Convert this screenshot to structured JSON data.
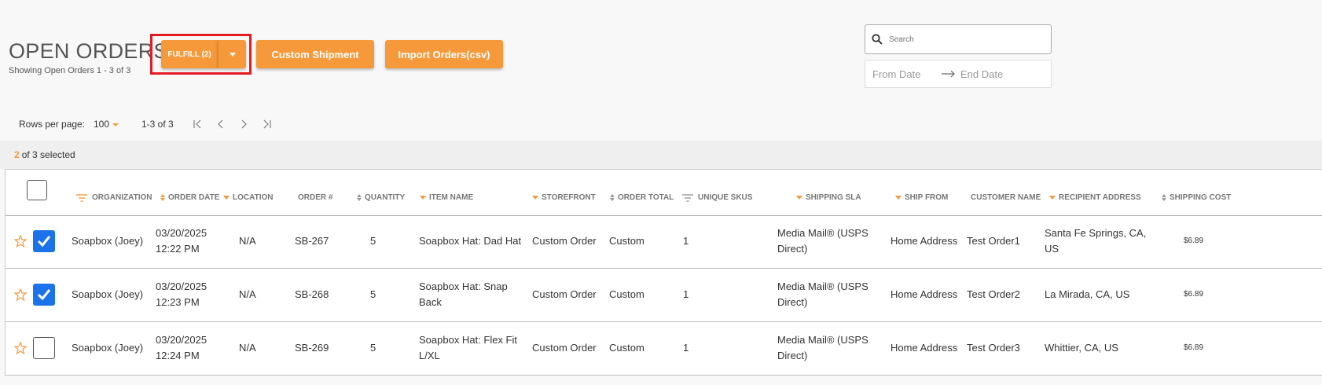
{
  "header": {
    "title": "OPEN ORDERS",
    "subtitle": "Showing Open Orders 1 - 3 of 3"
  },
  "toolbar": {
    "fulfill_label": "FULFILL (2)",
    "custom_shipment_label": "Custom Shipment",
    "import_orders_label": "Import Orders(csv)"
  },
  "search": {
    "placeholder": "Search"
  },
  "date_range": {
    "from_placeholder": "From Date",
    "end_placeholder": "End Date"
  },
  "pagination": {
    "rows_label": "Rows per page:",
    "rows_value": "100",
    "range": "1-3 of 3"
  },
  "selection": {
    "count": "2",
    "text": "of 3 selected"
  },
  "table": {
    "columns": {
      "organization": "ORGANIZATION",
      "order_date": "ORDER DATE",
      "location": "LOCATION",
      "order_no": "ORDER #",
      "quantity": "QUANTITY",
      "item_name": "ITEM NAME",
      "storefront": "STOREFRONT",
      "order_total": "ORDER TOTAL",
      "unique_skus": "UNIQUE SKUS",
      "shipping_sla": "SHIPPING SLA",
      "ship_from": "SHIP FROM",
      "customer_name": "CUSTOMER NAME",
      "recipient_address": "RECIPIENT ADDRESS",
      "shipping_cost": "SHIPPING COST"
    },
    "rows": [
      {
        "checked": true,
        "organization": "Soapbox (Joey)",
        "date": "03/20/2025",
        "time": "12:22 PM",
        "location": "N/A",
        "order_no": "SB-267",
        "quantity": "5",
        "item_line1": "Soapbox Hat: Dad Hat",
        "item_line2": "",
        "storefront": "Custom Order",
        "order_total": "Custom",
        "unique_skus": "1",
        "sla_line1": "Media Mail® (USPS",
        "sla_line2": "Direct)",
        "ship_from": "Home Address",
        "customer": "Test Order1",
        "addr_line1": "Santa Fe Springs, CA,",
        "addr_line2": "US",
        "cost": "$6.89"
      },
      {
        "checked": true,
        "organization": "Soapbox (Joey)",
        "date": "03/20/2025",
        "time": "12:23 PM",
        "location": "N/A",
        "order_no": "SB-268",
        "quantity": "5",
        "item_line1": "Soapbox Hat: Snap",
        "item_line2": "Back",
        "storefront": "Custom Order",
        "order_total": "Custom",
        "unique_skus": "1",
        "sla_line1": "Media Mail® (USPS",
        "sla_line2": "Direct)",
        "ship_from": "Home Address",
        "customer": "Test Order2",
        "addr_line1": "La Mirada, CA, US",
        "addr_line2": "",
        "cost": "$6.89"
      },
      {
        "checked": false,
        "organization": "Soapbox (Joey)",
        "date": "03/20/2025",
        "time": "12:24 PM",
        "location": "N/A",
        "order_no": "SB-269",
        "quantity": "5",
        "item_line1": "Soapbox Hat: Flex Fit",
        "item_line2": "L/XL",
        "storefront": "Custom Order",
        "order_total": "Custom",
        "unique_skus": "1",
        "sla_line1": "Media Mail® (USPS",
        "sla_line2": "Direct)",
        "ship_from": "Home Address",
        "customer": "Test Order3",
        "addr_line1": "Whittier, CA, US",
        "addr_line2": "",
        "cost": "$6.89"
      }
    ]
  },
  "colors": {
    "accent": "#f6993a",
    "checkbox": "#1a73e8",
    "highlight": "#e31b23"
  },
  "icons": [
    "search-icon",
    "arrow-right-icon",
    "first-page-icon",
    "prev-page-icon",
    "next-page-icon",
    "last-page-icon",
    "filter-icon",
    "sort-icon",
    "star-icon",
    "checkmark-icon",
    "chevron-down-icon"
  ]
}
